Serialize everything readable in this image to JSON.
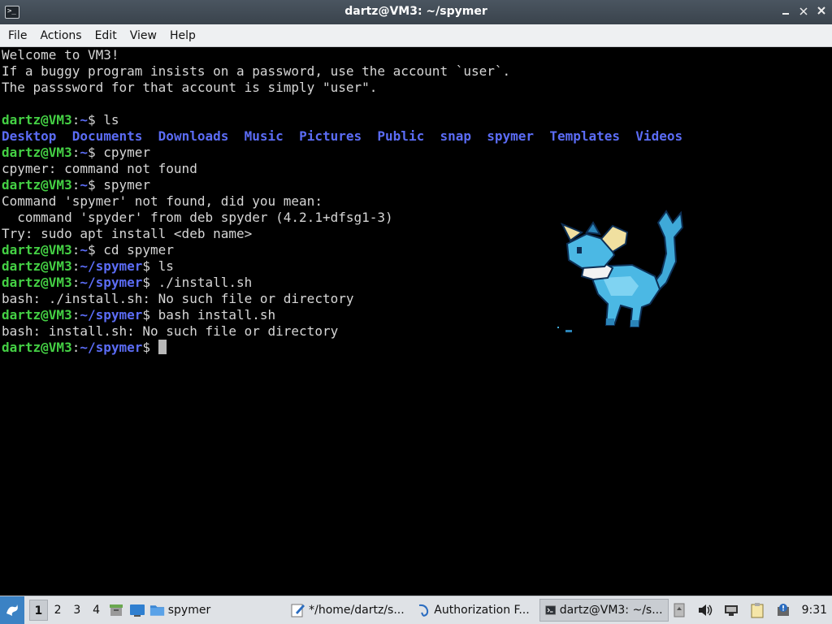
{
  "window": {
    "title": "dartz@VM3: ~/spymer"
  },
  "menu": [
    "File",
    "Actions",
    "Edit",
    "View",
    "Help"
  ],
  "terminal": {
    "lines": [
      {
        "type": "text",
        "text": "Welcome to VM3!"
      },
      {
        "type": "text",
        "text": "If a buggy program insists on a password, use the account `user`."
      },
      {
        "type": "text",
        "text": "The passsword for that account is simply \"user\"."
      },
      {
        "type": "blank"
      },
      {
        "type": "prompt",
        "user": "dartz@VM3",
        "path": "~",
        "cmd": "ls"
      },
      {
        "type": "dirs",
        "items": [
          "Desktop",
          "Documents",
          "Downloads",
          "Music",
          "Pictures",
          "Public",
          "snap",
          "spymer",
          "Templates",
          "Videos"
        ]
      },
      {
        "type": "prompt",
        "user": "dartz@VM3",
        "path": "~",
        "cmd": "cpymer"
      },
      {
        "type": "text",
        "text": "cpymer: command not found"
      },
      {
        "type": "prompt",
        "user": "dartz@VM3",
        "path": "~",
        "cmd": "spymer"
      },
      {
        "type": "text",
        "text": "Command 'spymer' not found, did you mean:"
      },
      {
        "type": "text",
        "text": "  command 'spyder' from deb spyder (4.2.1+dfsg1-3)"
      },
      {
        "type": "text",
        "text": "Try: sudo apt install <deb name>"
      },
      {
        "type": "prompt",
        "user": "dartz@VM3",
        "path": "~",
        "cmd": "cd spymer"
      },
      {
        "type": "prompt",
        "user": "dartz@VM3",
        "path": "~/spymer",
        "cmd": "ls"
      },
      {
        "type": "prompt",
        "user": "dartz@VM3",
        "path": "~/spymer",
        "cmd": "./install.sh"
      },
      {
        "type": "text",
        "text": "bash: ./install.sh: No such file or directory"
      },
      {
        "type": "prompt",
        "user": "dartz@VM3",
        "path": "~/spymer",
        "cmd": "bash install.sh"
      },
      {
        "type": "text",
        "text": "bash: install.sh: No such file or directory"
      },
      {
        "type": "prompt",
        "user": "dartz@VM3",
        "path": "~/spymer",
        "cmd": "",
        "cursor": true
      }
    ]
  },
  "taskbar": {
    "workspaces": [
      "1",
      "2",
      "3",
      "4"
    ],
    "active_workspace": "1",
    "folder_label": "spymer",
    "tasks": [
      {
        "label": "*/home/dartz/s...",
        "icon": "text-editor-icon",
        "active": false
      },
      {
        "label": "Authorization F...",
        "icon": "browser-icon",
        "active": false
      },
      {
        "label": "dartz@VM3: ~/s...",
        "icon": "terminal-icon",
        "active": true
      }
    ],
    "clock": "9:31"
  },
  "colors": {
    "prompt_user": "#44d044",
    "prompt_path": "#5b6cf5",
    "directory": "#5b6cf5",
    "terminal_bg": "#000000",
    "terminal_fg": "#d6d6d6"
  }
}
